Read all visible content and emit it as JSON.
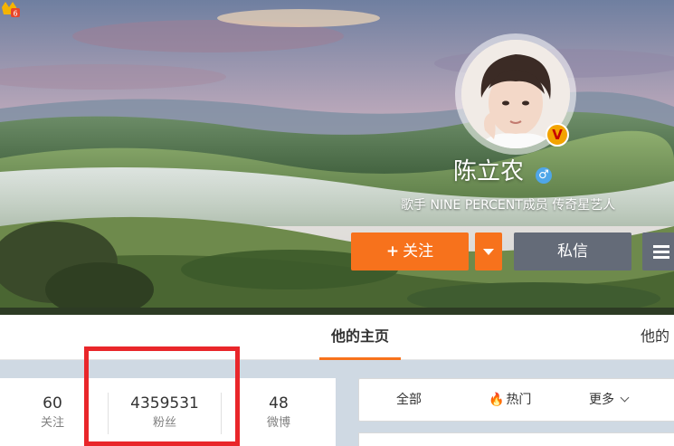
{
  "profile": {
    "name": "陈立农",
    "verified_badge": "V",
    "gender_symbol": "♂",
    "gender_icon": "male-icon",
    "level_icon": "member-level-icon",
    "bio": "歌手 NINE PERCENT成员 传奇星艺人"
  },
  "actions": {
    "follow_plus": "+",
    "follow_label": "关注",
    "message_label": "私信"
  },
  "tabs": {
    "home": "他的主页",
    "other": "他的"
  },
  "stats": [
    {
      "value": "60",
      "label": "关注"
    },
    {
      "value": "4359531",
      "label": "粉丝"
    },
    {
      "value": "48",
      "label": "微博"
    }
  ],
  "feed_tabs": {
    "all": "全部",
    "hot": "热门",
    "more": "更多"
  },
  "colors": {
    "accent": "#f7721c",
    "secondary_button": "#646b78",
    "highlight": "#e9262a"
  }
}
